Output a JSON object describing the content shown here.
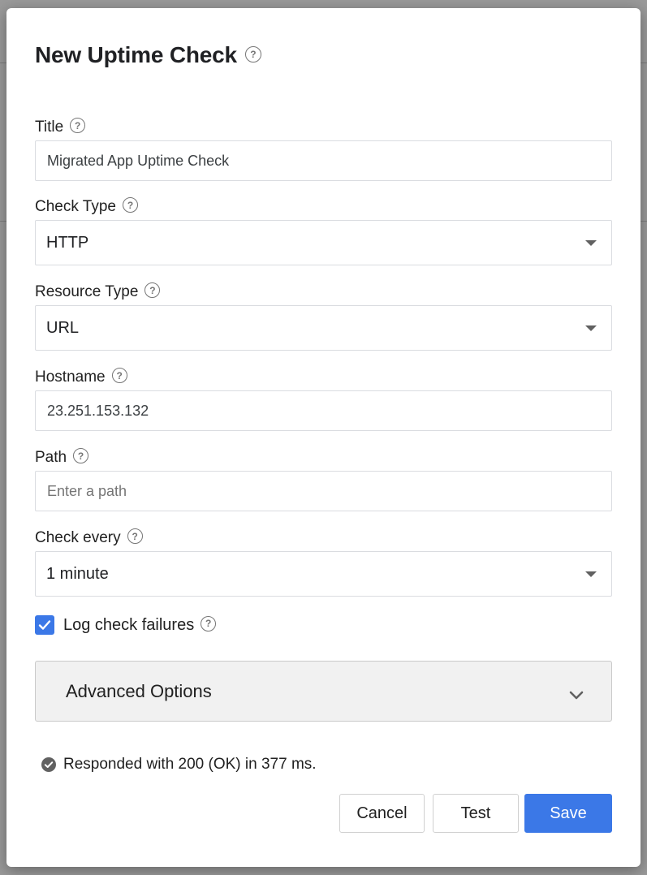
{
  "dialog": {
    "title": "New Uptime Check"
  },
  "fields": {
    "title": {
      "label": "Title",
      "value": "Migrated App Uptime Check"
    },
    "check_type": {
      "label": "Check Type",
      "value": "HTTP"
    },
    "resource_type": {
      "label": "Resource Type",
      "value": "URL"
    },
    "hostname": {
      "label": "Hostname",
      "value": "23.251.153.132"
    },
    "path": {
      "label": "Path",
      "value": "",
      "placeholder": "Enter a path"
    },
    "check_every": {
      "label": "Check every",
      "value": "1 minute"
    }
  },
  "log_failures": {
    "label": "Log check failures",
    "checked": true
  },
  "advanced": {
    "label": "Advanced Options"
  },
  "status": {
    "text": "Responded with 200 (OK) in 377 ms."
  },
  "buttons": {
    "cancel": "Cancel",
    "test": "Test",
    "save": "Save"
  },
  "icons": {
    "help": "help-circle-icon",
    "dropdown": "caret-down-icon",
    "check": "checkmark-icon",
    "expand": "chevron-down-icon",
    "status": "check-circle-icon"
  },
  "colors": {
    "primary": "#3b78e7",
    "panel": "#f1f1f1"
  }
}
